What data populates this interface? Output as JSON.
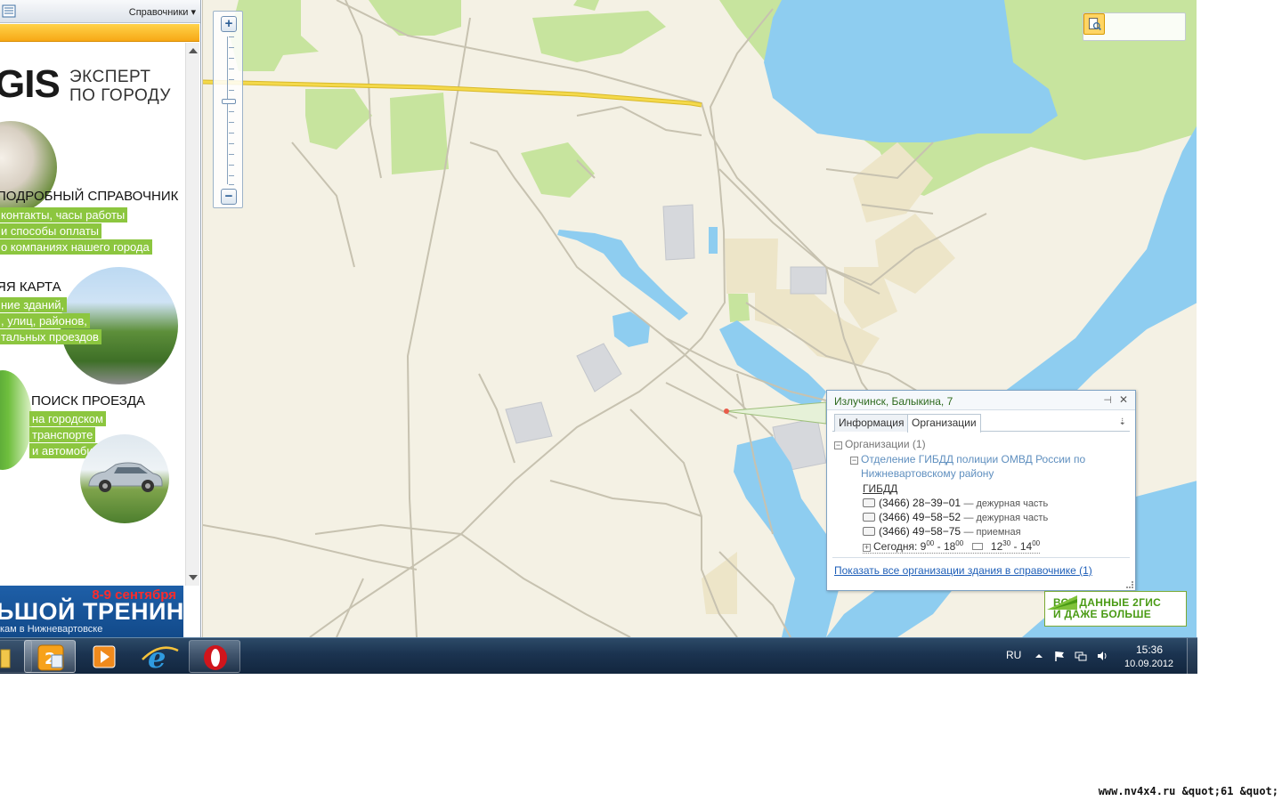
{
  "left_panel": {
    "title": "Справочники",
    "dropdown_glyph": "▾",
    "ad": {
      "logo": "GIS",
      "slogan_line1": "ЭКСПЕРТ",
      "slogan_line2": "ПО ГОРОДУ",
      "section1_title": "ПОДРОБНЫЙ СПРАВОЧНИК",
      "section1_lines": [
        "контакты, часы работы",
        "и способы оплаты",
        "о компаниях нашего города"
      ],
      "section2_title": "ЯЯ КАРТА",
      "section2_lines": [
        "ние зданий,",
        ", улиц, районов,",
        "тальных проездов"
      ],
      "section3_title": "ПОИСК ПРОЕЗДА",
      "section3_lines": [
        "на городском",
        "транспорте",
        "и автомобиле"
      ],
      "banner_date": "8-9 сентября",
      "banner_title": "ЬШОЙ ТРЕНИНГ",
      "banner_sub": "кам в Нижневартовске"
    }
  },
  "map": {
    "zoom_in_label": "+",
    "zoom_out_label": "−",
    "zoom_level": 0.56,
    "tools": [
      "ruler-icon",
      "globe-icon",
      "layers-icon",
      "print-icon"
    ],
    "popup": {
      "address": "Излучинск, Балыкина, 7",
      "pin_glyph": "⊣",
      "close_glyph": "✕",
      "tabs": [
        "Информация",
        "Организации"
      ],
      "active_tab": "Организации",
      "menu_glyph": "⇣",
      "orgs_root": "Организации (1)",
      "org_name": "Отделение ГИБДД полиции ОМВД России по Нижневартовскому району",
      "rubric": "ГИБДД",
      "phones": [
        {
          "number": "(3466) 28−39−01",
          "note": "— дежурная часть"
        },
        {
          "number": "(3466) 49−58−52",
          "note": "— дежурная часть"
        },
        {
          "number": "(3466) 49−58−75",
          "note": "— приемная"
        }
      ],
      "hours": {
        "label": "Сегодня:",
        "open_h": "9",
        "open_m": "00",
        "close_h": "18",
        "close_m": "00",
        "break_start_h": "12",
        "break_start_m": "30",
        "break_end_h": "14",
        "break_end_m": "00"
      },
      "link": "Показать все организации здания в справочнике",
      "link_count": "(1)"
    },
    "all_data_badge_line1": "ВСЕ ДАННЫЕ 2ГИС",
    "all_data_badge_line2": "И ДАЖЕ БОЛЬШЕ"
  },
  "taskbar": {
    "language": "RU",
    "time": "15:36",
    "date": "10.09.2012",
    "apps": [
      "explorer-icon",
      "2gis-icon",
      "media-player-icon",
      "internet-explorer-icon",
      "opera-icon"
    ]
  },
  "watermark": "www.nv4x4.ru &quot;61 &quot;",
  "colors": {
    "water": "#8ecdf0",
    "forest": "#c7e49e",
    "land": "#f4f1e4",
    "road_main": "#f4d94a",
    "accent_green": "#8cc63f",
    "link_blue": "#1f5fb8"
  }
}
